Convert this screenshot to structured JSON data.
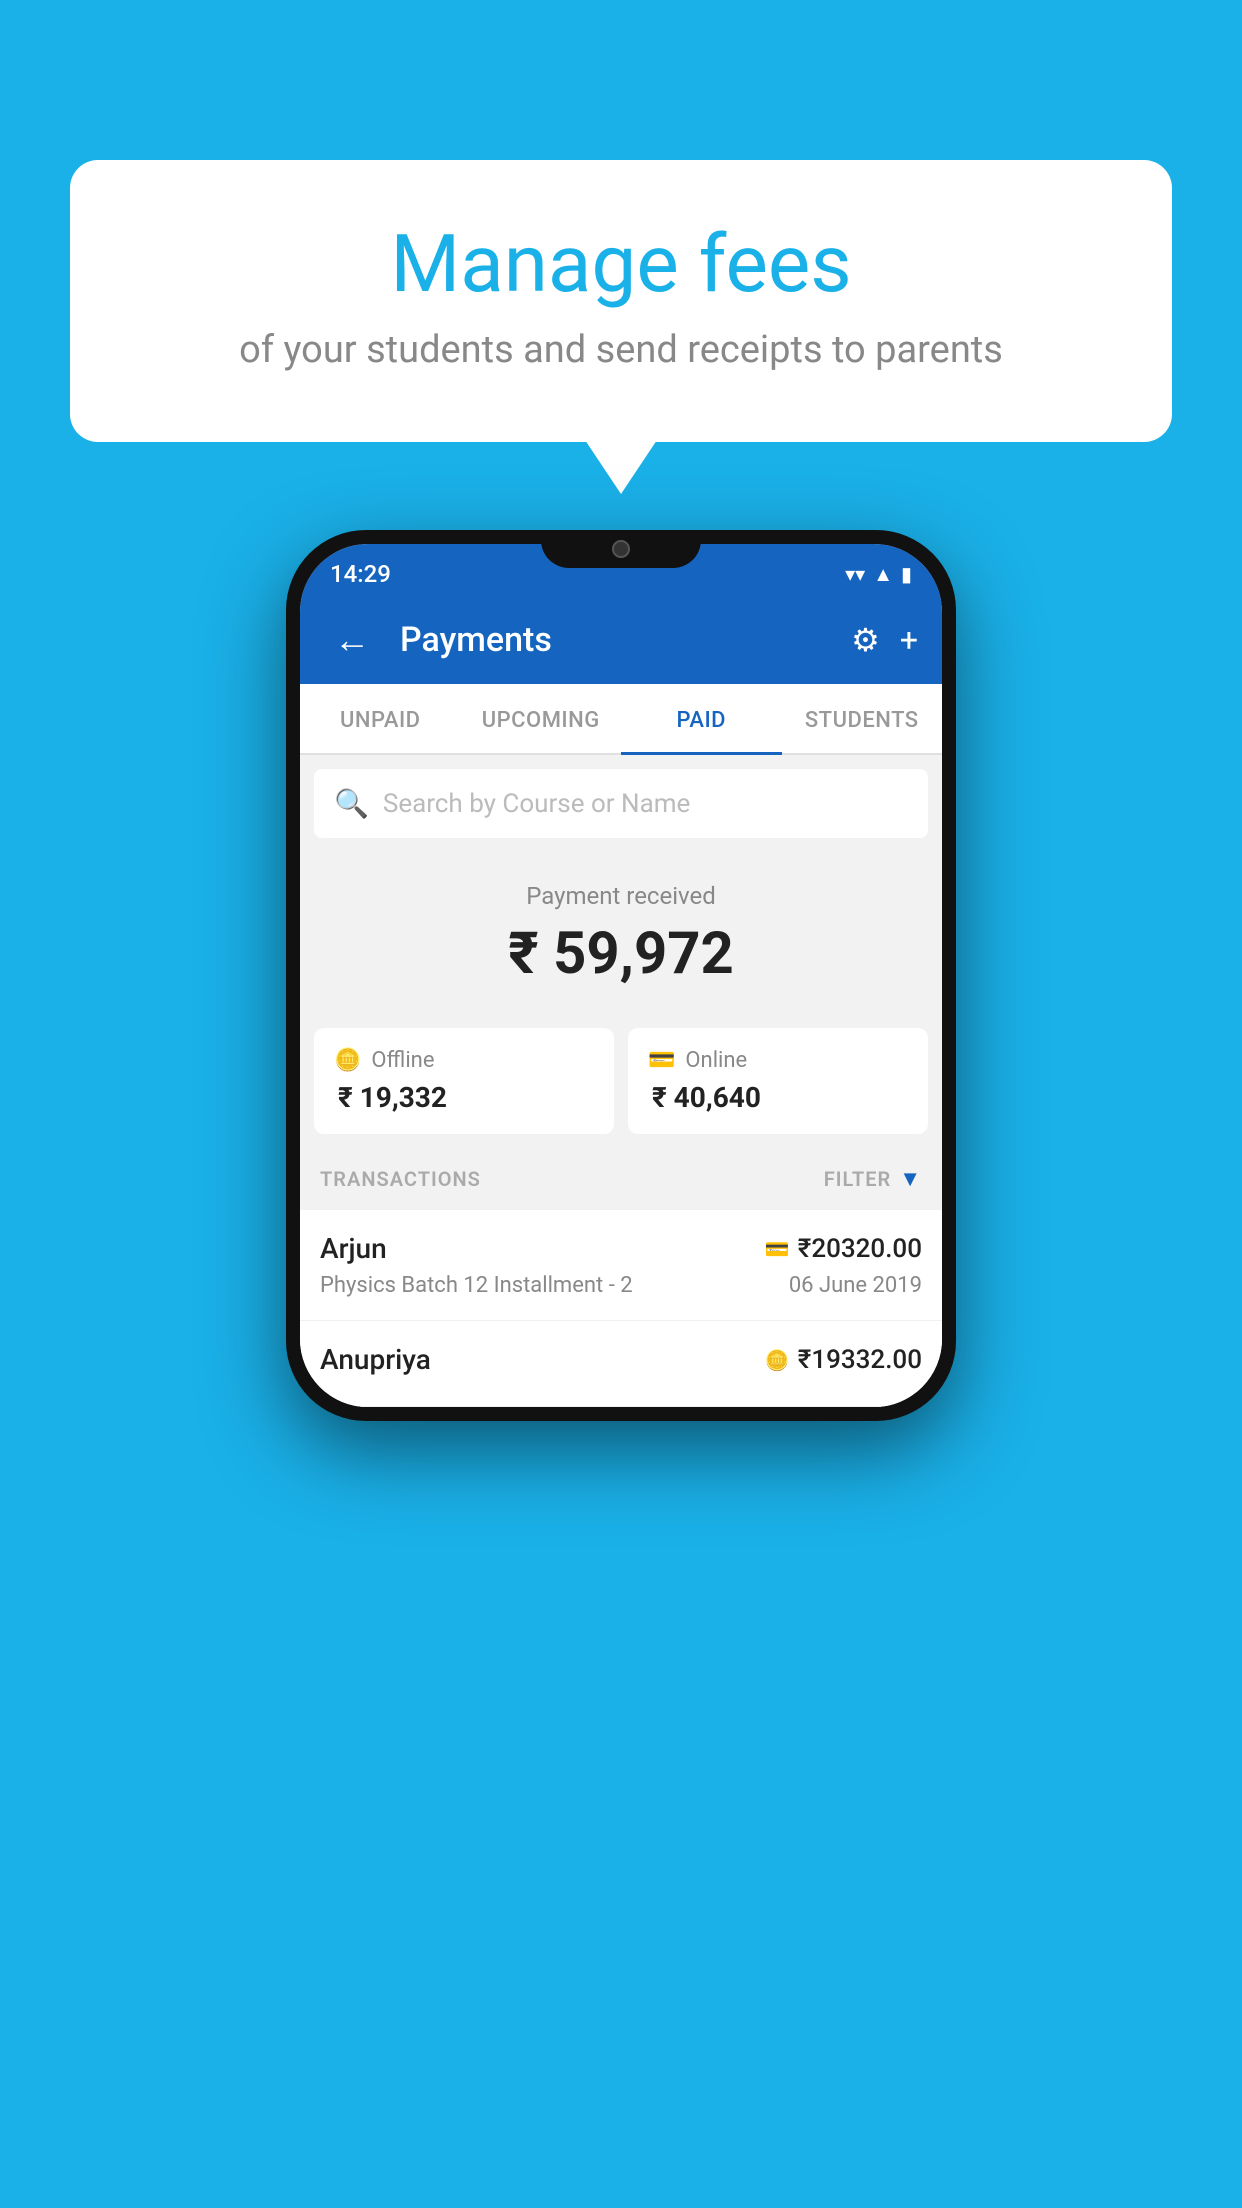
{
  "background_color": "#1ab0e8",
  "speech_bubble": {
    "title": "Manage fees",
    "subtitle": "of your students and send receipts to parents"
  },
  "status_bar": {
    "time": "14:29",
    "icons": [
      "wifi",
      "signal",
      "battery"
    ]
  },
  "app_bar": {
    "title": "Payments",
    "back_label": "←",
    "settings_label": "⚙",
    "add_label": "+"
  },
  "tabs": [
    {
      "label": "UNPAID",
      "active": false
    },
    {
      "label": "UPCOMING",
      "active": false
    },
    {
      "label": "PAID",
      "active": true
    },
    {
      "label": "STUDENTS",
      "active": false
    }
  ],
  "search": {
    "placeholder": "Search by Course or Name"
  },
  "payment_received": {
    "label": "Payment received",
    "amount": "₹ 59,972",
    "offline": {
      "label": "Offline",
      "amount": "₹ 19,332"
    },
    "online": {
      "label": "Online",
      "amount": "₹ 40,640"
    }
  },
  "transactions": {
    "header_label": "TRANSACTIONS",
    "filter_label": "FILTER",
    "rows": [
      {
        "name": "Arjun",
        "course": "Physics Batch 12 Installment - 2",
        "amount": "₹20320.00",
        "date": "06 June 2019",
        "pay_type": "card"
      },
      {
        "name": "Anupriya",
        "course": "",
        "amount": "₹19332.00",
        "date": "",
        "pay_type": "cash"
      }
    ]
  }
}
